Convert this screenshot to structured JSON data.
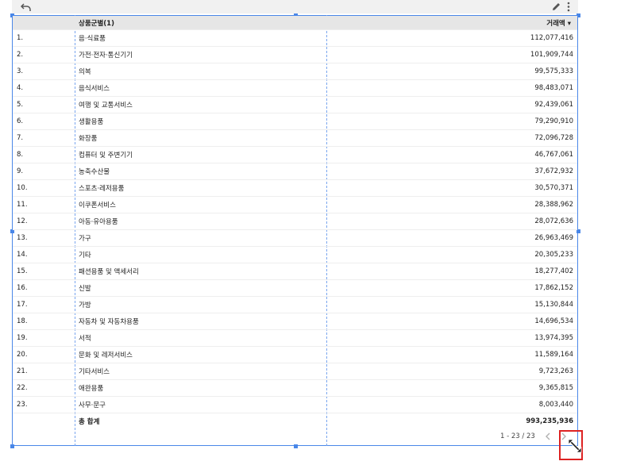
{
  "toolbar": {
    "undo_icon": "undo-icon",
    "edit_icon": "pencil-icon",
    "more_icon": "more-vert-icon"
  },
  "table": {
    "headers": {
      "number": "",
      "category": "상품군별(1)",
      "value": "거래액"
    },
    "sort_indicator": "▾",
    "rows": [
      {
        "num": "1.",
        "category": "음·식료품",
        "value": "112,077,416"
      },
      {
        "num": "2.",
        "category": "가전·전자·통신기기",
        "value": "101,909,744"
      },
      {
        "num": "3.",
        "category": "의복",
        "value": "99,575,333"
      },
      {
        "num": "4.",
        "category": "음식서비스",
        "value": "98,483,071"
      },
      {
        "num": "5.",
        "category": "여행 및 교통서비스",
        "value": "92,439,061"
      },
      {
        "num": "6.",
        "category": "생활용품",
        "value": "79,290,910"
      },
      {
        "num": "7.",
        "category": "화장품",
        "value": "72,096,728"
      },
      {
        "num": "8.",
        "category": "컴퓨터 및 주변기기",
        "value": "46,767,061"
      },
      {
        "num": "9.",
        "category": "농축수산물",
        "value": "37,672,932"
      },
      {
        "num": "10.",
        "category": "스포츠·레저용품",
        "value": "30,570,371"
      },
      {
        "num": "11.",
        "category": "이쿠폰서비스",
        "value": "28,388,962"
      },
      {
        "num": "12.",
        "category": "아동·유아용품",
        "value": "28,072,636"
      },
      {
        "num": "13.",
        "category": "가구",
        "value": "26,963,469"
      },
      {
        "num": "14.",
        "category": "기타",
        "value": "20,305,233"
      },
      {
        "num": "15.",
        "category": "패션용품 및 액세서리",
        "value": "18,277,402"
      },
      {
        "num": "16.",
        "category": "신발",
        "value": "17,862,152"
      },
      {
        "num": "17.",
        "category": "가방",
        "value": "15,130,844"
      },
      {
        "num": "18.",
        "category": "자동차 및 자동차용품",
        "value": "14,696,534"
      },
      {
        "num": "19.",
        "category": "서적",
        "value": "13,974,395"
      },
      {
        "num": "20.",
        "category": "문화 및 레저서비스",
        "value": "11,589,164"
      },
      {
        "num": "21.",
        "category": "기타서비스",
        "value": "9,723,263"
      },
      {
        "num": "22.",
        "category": "애완용품",
        "value": "9,365,815"
      },
      {
        "num": "23.",
        "category": "사무·문구",
        "value": "8,003,440"
      }
    ],
    "total": {
      "label": "총 합계",
      "value": "993,235,936"
    }
  },
  "pagination": {
    "range": "1 - 23 / 23",
    "prev_icon": "chevron-left-icon",
    "next_icon": "chevron-right-icon"
  },
  "resize": {
    "icon": "resize-handle-icon"
  },
  "colors": {
    "selection": "#4a87e8",
    "header_bg": "#e6e6e6",
    "highlight": "#dd2222"
  }
}
